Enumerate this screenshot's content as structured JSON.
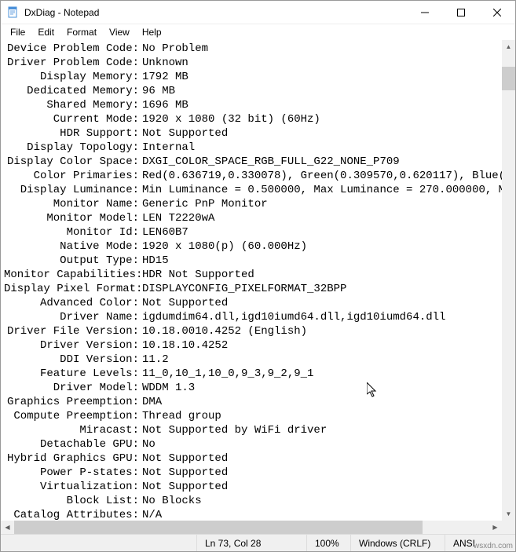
{
  "window": {
    "title": "DxDiag - Notepad"
  },
  "menu": {
    "file": "File",
    "edit": "Edit",
    "format": "Format",
    "view": "View",
    "help": "Help"
  },
  "rows": [
    {
      "label": "Device Problem Code:",
      "value": "No Problem"
    },
    {
      "label": "Driver Problem Code:",
      "value": "Unknown"
    },
    {
      "label": "Display Memory:",
      "value": "1792 MB"
    },
    {
      "label": "Dedicated Memory:",
      "value": "96 MB"
    },
    {
      "label": "Shared Memory:",
      "value": "1696 MB"
    },
    {
      "label": "Current Mode:",
      "value": "1920 x 1080 (32 bit) (60Hz)"
    },
    {
      "label": "HDR Support:",
      "value": "Not Supported"
    },
    {
      "label": "Display Topology:",
      "value": "Internal"
    },
    {
      "label": "Display Color Space:",
      "value": "DXGI_COLOR_SPACE_RGB_FULL_G22_NONE_P709"
    },
    {
      "label": "Color Primaries:",
      "value": "Red(0.636719,0.330078), Green(0.309570,0.620117), Blue("
    },
    {
      "label": "Display Luminance:",
      "value": "Min Luminance = 0.500000, Max Luminance = 270.000000, M"
    },
    {
      "label": "Monitor Name:",
      "value": "Generic PnP Monitor"
    },
    {
      "label": "Monitor Model:",
      "value": "LEN T2220wA"
    },
    {
      "label": "Monitor Id:",
      "value": "LEN60B7"
    },
    {
      "label": "Native Mode:",
      "value": "1920 x 1080(p) (60.000Hz)"
    },
    {
      "label": "Output Type:",
      "value": "HD15"
    },
    {
      "label": "Monitor Capabilities:",
      "value": "HDR Not Supported"
    },
    {
      "label": "Display Pixel Format:",
      "value": "DISPLAYCONFIG_PIXELFORMAT_32BPP"
    },
    {
      "label": "Advanced Color:",
      "value": "Not Supported"
    },
    {
      "label": "Driver Name:",
      "value": "igdumdim64.dll,igd10iumd64.dll,igd10iumd64.dll"
    },
    {
      "label": "Driver File Version:",
      "value": "10.18.0010.4252 (English)"
    },
    {
      "label": "Driver Version:",
      "value": "10.18.10.4252"
    },
    {
      "label": "DDI Version:",
      "value": "11.2"
    },
    {
      "label": "Feature Levels:",
      "value": "11_0,10_1,10_0,9_3,9_2,9_1"
    },
    {
      "label": "Driver Model:",
      "value": "WDDM 1.3"
    },
    {
      "label": "Graphics Preemption:",
      "value": "DMA"
    },
    {
      "label": "Compute Preemption:",
      "value": "Thread group"
    },
    {
      "label": "Miracast:",
      "value": "Not Supported by WiFi driver"
    },
    {
      "label": "Detachable GPU:",
      "value": "No"
    },
    {
      "label": "Hybrid Graphics GPU:",
      "value": "Not Supported"
    },
    {
      "label": "Power P-states:",
      "value": "Not Supported"
    },
    {
      "label": "Virtualization:",
      "value": "Not Supported"
    },
    {
      "label": "Block List:",
      "value": "No Blocks"
    },
    {
      "label": "Catalog Attributes:",
      "value": "N/A"
    }
  ],
  "status": {
    "position": "Ln 73, Col 28",
    "zoom": "100%",
    "eol": "Windows (CRLF)",
    "encoding": "ANSI"
  },
  "watermark": "wsxdn.com"
}
